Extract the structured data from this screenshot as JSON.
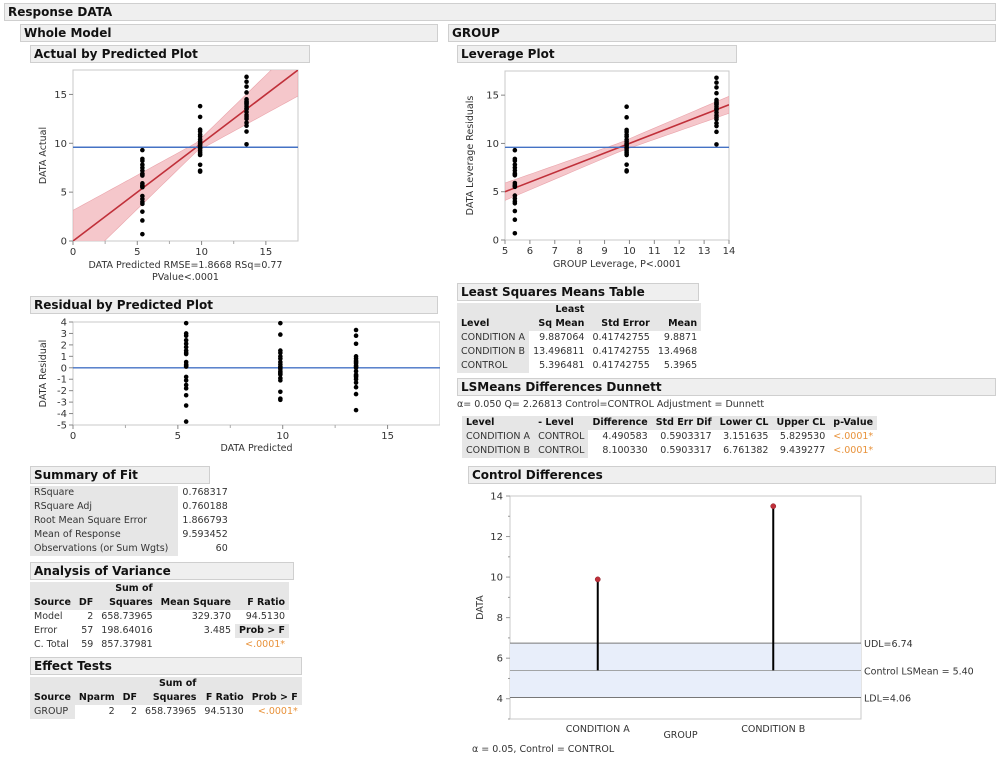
{
  "headers": {
    "response": "Response DATA",
    "whole_model": "Whole Model",
    "actual_by_predicted": "Actual by Predicted Plot",
    "residual_by_predicted": "Residual by Predicted Plot",
    "summary_of_fit": "Summary of Fit",
    "analysis_of_variance": "Analysis of Variance",
    "effect_tests": "Effect Tests",
    "group": "GROUP",
    "leverage_plot": "Leverage Plot",
    "ls_means_table": "Least Squares Means Table",
    "lsmeans_dunnett": "LSMeans Differences Dunnett",
    "control_differences": "Control Differences"
  },
  "summary_of_fit": {
    "rows": [
      {
        "label": "RSquare",
        "value": "0.768317"
      },
      {
        "label": "RSquare Adj",
        "value": "0.760188"
      },
      {
        "label": "Root Mean Square Error",
        "value": "1.866793"
      },
      {
        "label": "Mean of Response",
        "value": "9.593452"
      },
      {
        "label": "Observations (or Sum Wgts)",
        "value": "60"
      }
    ]
  },
  "anova": {
    "headers": {
      "source": "Source",
      "df": "DF",
      "ss1": "Sum of",
      "ss2": "Squares",
      "ms": "Mean Square",
      "f": "F Ratio"
    },
    "rows": [
      {
        "source": "Model",
        "df": "2",
        "ss": "658.73965",
        "ms": "329.370",
        "extra": "94.5130"
      },
      {
        "source": "Error",
        "df": "57",
        "ss": "198.64016",
        "ms": "3.485",
        "extra": "Prob > F"
      },
      {
        "source": "C. Total",
        "df": "59",
        "ss": "857.37981",
        "ms": "",
        "extra": "<.0001*"
      }
    ]
  },
  "effect_tests": {
    "headers": {
      "source": "Source",
      "nparm": "Nparm",
      "df": "DF",
      "ss1": "Sum of",
      "ss2": "Squares",
      "f": "F Ratio",
      "p": "Prob > F"
    },
    "rows": [
      {
        "source": "GROUP",
        "nparm": "2",
        "df": "2",
        "ss": "658.73965",
        "f": "94.5130",
        "p": "<.0001*"
      }
    ]
  },
  "ls_means": {
    "headers": {
      "level": "Level",
      "lsm1": "Least",
      "lsm2": "Sq Mean",
      "se": "Std Error",
      "mean": "Mean"
    },
    "rows": [
      {
        "level": "CONDITION A",
        "lsm": "9.887064",
        "se": "0.41742755",
        "mean": "9.8871"
      },
      {
        "level": "CONDITION B",
        "lsm": "13.496811",
        "se": "0.41742755",
        "mean": "13.4968"
      },
      {
        "level": "CONTROL",
        "lsm": "5.396481",
        "se": "0.41742755",
        "mean": "5.3965"
      }
    ]
  },
  "dunnett": {
    "info": "α= 0.050  Q= 2.26813  Control=CONTROL  Adjustment = Dunnett",
    "headers": {
      "level": "Level",
      "minus_level": "- Level",
      "diff": "Difference",
      "sed": "Std Err Dif",
      "lcl": "Lower CL",
      "ucl": "Upper CL",
      "p": "p-Value"
    },
    "rows": [
      {
        "level": "CONDITION A",
        "minus_level": "CONTROL",
        "diff": "4.490583",
        "sed": "0.5903317",
        "lcl": "3.151635",
        "ucl": "5.829530",
        "p": "<.0001*"
      },
      {
        "level": "CONDITION B",
        "minus_level": "CONTROL",
        "diff": "8.100330",
        "sed": "0.5903317",
        "lcl": "6.761382",
        "ucl": "9.439277",
        "p": "<.0001*"
      }
    ]
  },
  "colors": {
    "fit_line": "#c0303a",
    "conf_band": "#f4c2c6",
    "mean_line": "#4472c4",
    "points": "#000000",
    "decision_band": "#e8eefa",
    "p_value": "#e8923a"
  },
  "chart_data": [
    {
      "type": "scatter",
      "id": "actual-by-predicted",
      "title": "Actual by Predicted Plot",
      "xlabel": "DATA Predicted RMSE=1.8668 RSq=0.77",
      "xlabel2": "PValue<.0001",
      "ylabel": "DATA Actual",
      "xlim": [
        0,
        17.5
      ],
      "ylim": [
        0,
        17.5
      ],
      "xticks": [
        0,
        5,
        10,
        15
      ],
      "yticks": [
        0,
        5,
        10,
        15
      ],
      "mean_line": 9.593452,
      "fit": {
        "slope": 1,
        "intercept": 0
      },
      "groups": [
        {
          "x": 5.396,
          "y": [
            9.3,
            8.4,
            8.2,
            7.8,
            7.5,
            7.2,
            6.9,
            6.8,
            6.7,
            5.9,
            5.7,
            5.6,
            5.5,
            4.6,
            4.3,
            4.0,
            3.8,
            3.0,
            2.1,
            0.7
          ]
        },
        {
          "x": 9.887,
          "y": [
            13.8,
            12.7,
            11.4,
            11.2,
            10.9,
            10.7,
            10.4,
            10.2,
            10.0,
            9.8,
            9.6,
            9.5,
            9.3,
            9.1,
            8.9,
            8.8,
            7.8,
            7.2,
            7.1,
            9.9
          ]
        },
        {
          "x": 13.497,
          "y": [
            16.8,
            16.3,
            15.8,
            15.2,
            14.5,
            14.3,
            14.1,
            14.0,
            13.8,
            13.5,
            13.2,
            12.9,
            12.7,
            12.5,
            12.1,
            11.8,
            11.2,
            9.9,
            13.6,
            14.2
          ]
        }
      ]
    },
    {
      "type": "scatter",
      "id": "residual-by-predicted",
      "title": "Residual by Predicted Plot",
      "xlabel": "DATA Predicted",
      "ylabel": "DATA Residual",
      "xlim": [
        0,
        17.5
      ],
      "ylim": [
        -5,
        4
      ],
      "xticks": [
        0,
        5,
        10,
        15
      ],
      "yticks": [
        4,
        3,
        2,
        1,
        0,
        -1,
        -2,
        -3,
        -4,
        -5
      ],
      "zero_line": 0,
      "groups": [
        {
          "x": 5.396,
          "y": [
            3.9,
            3.0,
            2.8,
            2.4,
            2.1,
            1.8,
            1.5,
            1.3,
            0.5,
            0.3,
            0.2,
            0.1,
            -0.8,
            -1.1,
            -1.5,
            -1.8,
            -2.4,
            -3.3,
            -4.7,
            1.2
          ]
        },
        {
          "x": 9.887,
          "y": [
            3.9,
            2.9,
            1.5,
            1.3,
            1.0,
            0.8,
            0.5,
            0.3,
            0.1,
            -0.1,
            -0.3,
            -0.5,
            -0.6,
            -0.9,
            -1.1,
            -2.1,
            -2.7,
            -2.8,
            0.0,
            -0.4
          ]
        },
        {
          "x": 13.497,
          "y": [
            3.3,
            2.8,
            2.1,
            1.0,
            0.8,
            0.6,
            0.4,
            0.2,
            0.0,
            -0.3,
            -0.6,
            -0.8,
            -1.0,
            -1.3,
            -1.7,
            -2.3,
            -3.7,
            0.5,
            -0.7,
            0.1
          ]
        }
      ]
    },
    {
      "type": "scatter",
      "id": "leverage-plot",
      "title": "Leverage Plot",
      "xlabel": "GROUP Leverage, P<.0001",
      "ylabel": "DATA Leverage Residuals",
      "xlim": [
        5,
        14
      ],
      "ylim": [
        0,
        17.5
      ],
      "xticks": [
        5,
        6,
        7,
        8,
        9,
        10,
        11,
        12,
        13,
        14
      ],
      "yticks": [
        0,
        5,
        10,
        15
      ],
      "mean_line": 9.593452,
      "fit": {
        "slope": 1,
        "intercept": 0
      },
      "groups": [
        {
          "x": 5.396,
          "y": [
            9.3,
            8.4,
            8.2,
            7.8,
            7.5,
            7.2,
            6.9,
            6.8,
            6.7,
            5.9,
            5.7,
            5.6,
            5.5,
            4.6,
            4.3,
            4.0,
            3.8,
            3.0,
            2.1,
            0.7
          ]
        },
        {
          "x": 9.887,
          "y": [
            13.8,
            12.7,
            11.4,
            11.2,
            10.9,
            10.7,
            10.4,
            10.2,
            10.0,
            9.8,
            9.6,
            9.5,
            9.3,
            9.1,
            8.9,
            8.8,
            7.8,
            7.2,
            7.1,
            9.9
          ]
        },
        {
          "x": 13.497,
          "y": [
            16.8,
            16.3,
            15.8,
            15.2,
            14.5,
            14.3,
            14.1,
            14.0,
            13.8,
            13.5,
            13.2,
            12.9,
            12.7,
            12.5,
            12.1,
            11.8,
            11.2,
            9.9,
            13.6,
            14.2
          ]
        }
      ]
    },
    {
      "type": "line",
      "id": "control-differences",
      "title": "Control Differences",
      "xlabel": "GROUP",
      "ylabel": "DATA",
      "ylim": [
        3,
        14
      ],
      "yticks": [
        4,
        6,
        8,
        10,
        12,
        14
      ],
      "categories": [
        "CONDITION A",
        "CONDITION B"
      ],
      "values": [
        9.887064,
        13.496811
      ],
      "control_mean": 5.396481,
      "udl": 6.74,
      "ldl": 4.06,
      "udl_label": "UDL=6.74",
      "control_label": "Control LSMean = 5.40",
      "ldl_label": "LDL=4.06",
      "footnote": "α = 0.05, Control = CONTROL"
    }
  ]
}
